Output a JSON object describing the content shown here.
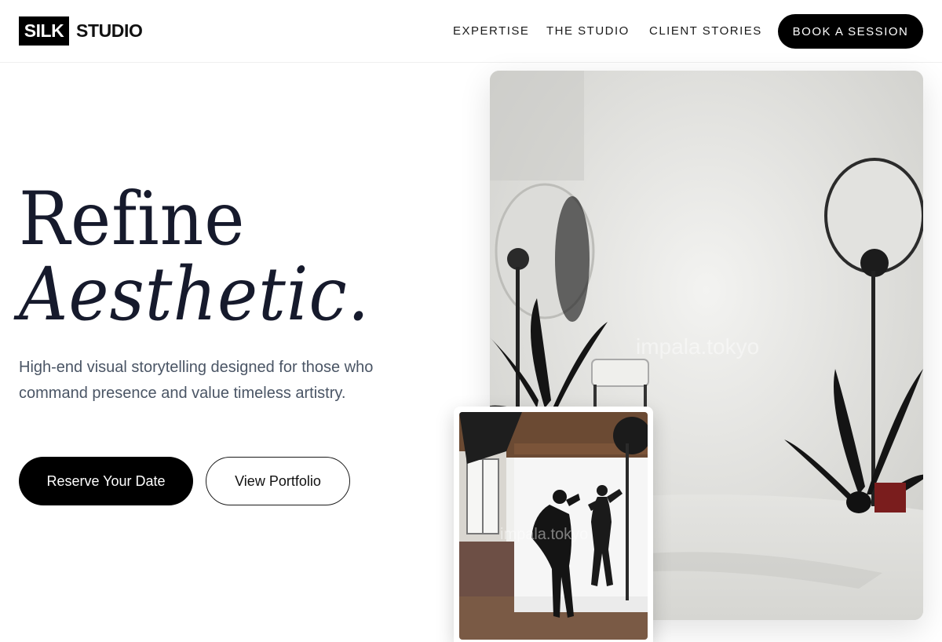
{
  "header": {
    "logo_box": "SILK",
    "logo_text": "STUDIO",
    "nav": [
      "EXPERTISE",
      "THE STUDIO",
      "CLIENT STORIES"
    ],
    "cta_label": "BOOK A SESSION"
  },
  "hero": {
    "title_line1": "Refine",
    "title_line2": "Aesthetic.",
    "subtitle": "High-end visual storytelling designed for those who command presence and value timeless artistry.",
    "primary_button": "Reserve Your Date",
    "secondary_button": "View Portfolio"
  },
  "images": {
    "main_watermark": "impala.tokyo",
    "inset_watermark": "impala.tokyo"
  }
}
